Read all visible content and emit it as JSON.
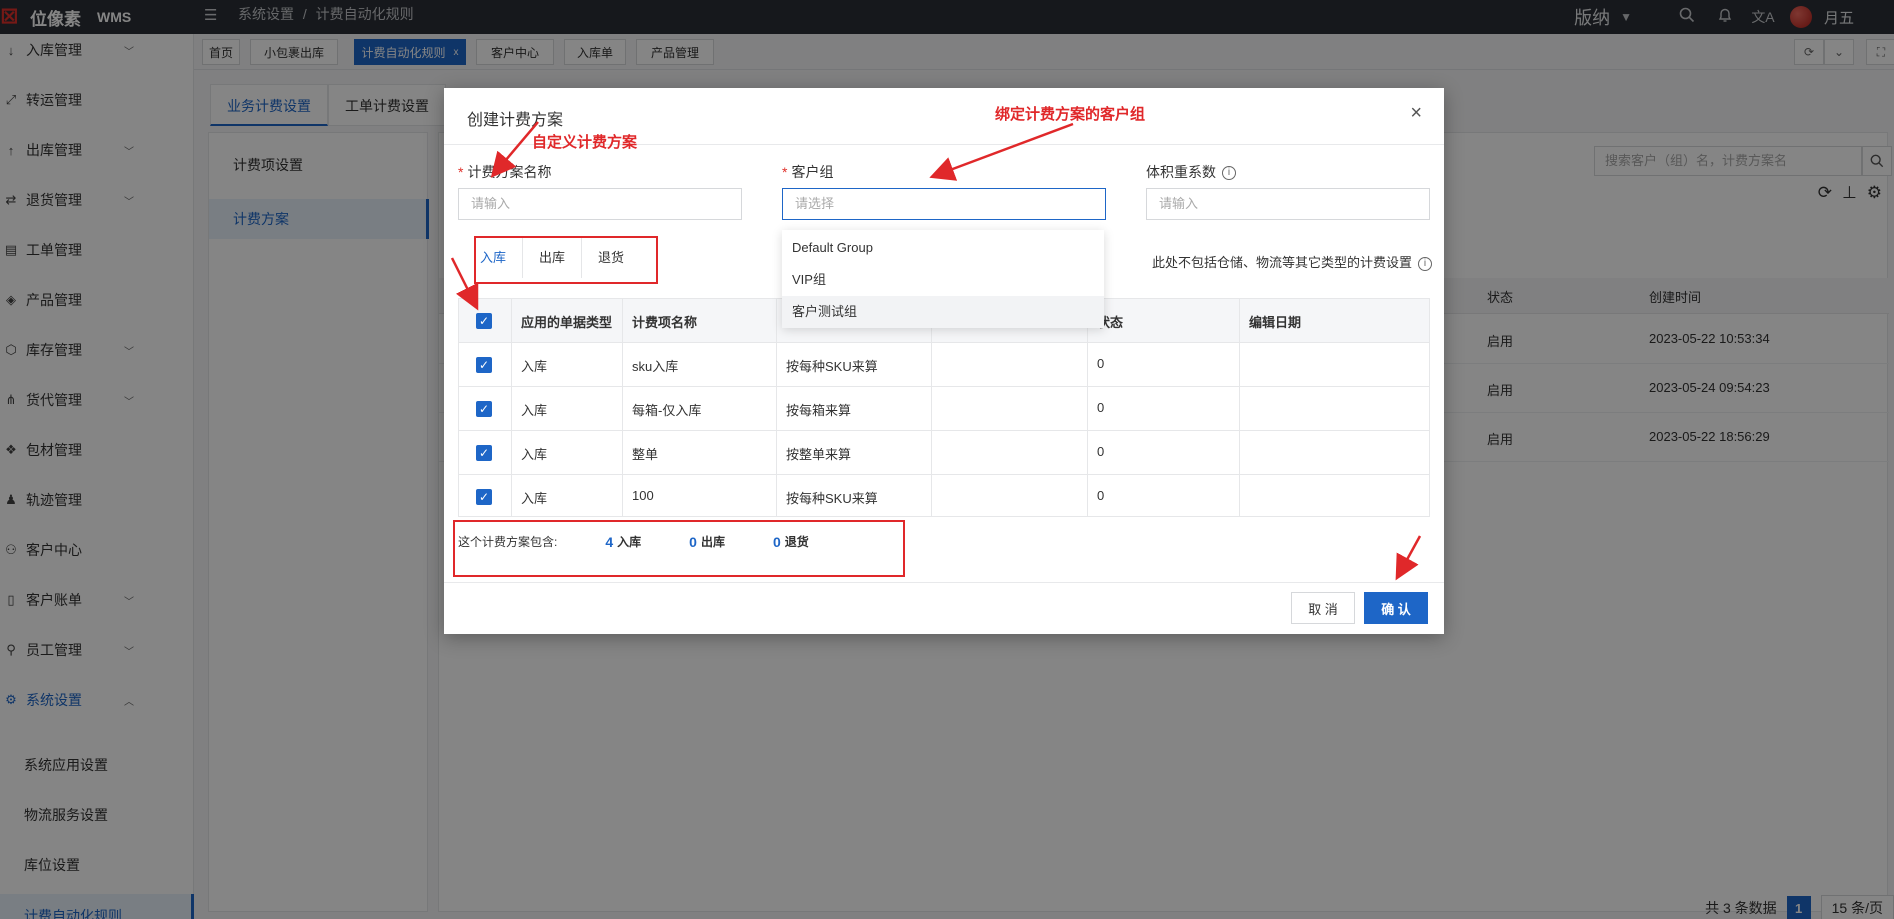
{
  "app": {
    "logo_cn": "位像素",
    "logo_en": "WMS",
    "breadcrumb": [
      "系统设置",
      "计费自动化规则"
    ],
    "breadcrumb_sep": "/",
    "warehouse": "版纳",
    "user": "月五"
  },
  "sidebar": {
    "items": [
      {
        "label": "入库管理",
        "icon": "arrow-down-icon",
        "caret": true
      },
      {
        "label": "转运管理",
        "icon": "transfer-icon",
        "caret": false
      },
      {
        "label": "出库管理",
        "icon": "arrow-up-icon",
        "caret": true
      },
      {
        "label": "退货管理",
        "icon": "return-icon",
        "caret": true
      },
      {
        "label": "工单管理",
        "icon": "clipboard-icon",
        "caret": false
      },
      {
        "label": "产品管理",
        "icon": "cube-icon",
        "caret": false
      },
      {
        "label": "库存管理",
        "icon": "box-icon",
        "caret": true
      },
      {
        "label": "货代管理",
        "icon": "network-icon",
        "caret": true
      },
      {
        "label": "包材管理",
        "icon": "package-icon",
        "caret": false
      },
      {
        "label": "轨迹管理",
        "icon": "bell-icon",
        "caret": false
      },
      {
        "label": "客户中心",
        "icon": "customer-icon",
        "caret": false
      },
      {
        "label": "客户账单",
        "icon": "bill-icon",
        "caret": true
      },
      {
        "label": "员工管理",
        "icon": "user-icon",
        "caret": true
      },
      {
        "label": "系统设置",
        "icon": "gear-icon",
        "caret": true,
        "expanded": true
      }
    ],
    "subitems": [
      {
        "label": "系统应用设置"
      },
      {
        "label": "物流服务设置"
      },
      {
        "label": "库位设置"
      },
      {
        "label": "计费自动化规则",
        "active": true
      }
    ]
  },
  "tabs": [
    {
      "label": "首页"
    },
    {
      "label": "小包裹出库"
    },
    {
      "label": "计费自动化规则",
      "active": true,
      "close": "x"
    },
    {
      "label": "客户中心"
    },
    {
      "label": "入库单"
    },
    {
      "label": "产品管理"
    }
  ],
  "page": {
    "subtabs": [
      "业务计费设置",
      "工单计费设置"
    ],
    "left_menu": [
      "计费项设置",
      "计费方案"
    ],
    "search_placeholder": "搜索客户（组）名，计费方案名",
    "bg_table": {
      "headers": [
        "状态",
        "创建时间"
      ],
      "rows": [
        [
          "启用",
          "2023-05-22 10:53:34"
        ],
        [
          "启用",
          "2023-05-24 09:54:23"
        ],
        [
          "启用",
          "2023-05-22 18:56:29"
        ]
      ]
    },
    "pager": {
      "total": "共 3 条数据",
      "page": "1",
      "size": "15 条/页"
    }
  },
  "modal": {
    "title": "创建计费方案",
    "close": "×",
    "fields": {
      "name_label": "计费方案名称",
      "name_placeholder": "请输入",
      "group_label": "客户组",
      "group_placeholder": "请选择",
      "volume_label": "体积重系数",
      "volume_placeholder": "请输入"
    },
    "tabs": [
      "入库",
      "出库",
      "退货"
    ],
    "note": "此处不包括仓储、物流等其它类型的计费设置",
    "table": {
      "headers": [
        "应用的单据类型",
        "计费项名称",
        "",
        "",
        "状态",
        "编辑日期"
      ],
      "rows": [
        [
          "入库",
          "sku入库",
          "按每种SKU来算",
          "",
          "0",
          ""
        ],
        [
          "入库",
          "每箱-仅入库",
          "按每箱来算",
          "",
          "0",
          ""
        ],
        [
          "入库",
          "整单",
          "按整单来算",
          "",
          "0",
          ""
        ],
        [
          "入库",
          "100",
          "按每种SKU来算",
          "",
          "0",
          ""
        ]
      ]
    },
    "summary": {
      "label": "这个计费方案包含:",
      "items": [
        {
          "num": "4",
          "label": "入库"
        },
        {
          "num": "0",
          "label": "出库"
        },
        {
          "num": "0",
          "label": "退货"
        }
      ]
    },
    "buttons": {
      "cancel": "取 消",
      "ok": "确 认"
    }
  },
  "dropdown": {
    "options": [
      "Default Group",
      "VIP组",
      "客户测试组"
    ]
  },
  "annotations": {
    "custom_plan": "自定义计费方案",
    "bind_group": "绑定计费方案的客户组"
  },
  "colors": {
    "accent": "#1e66c7",
    "annotation": "#e0282a",
    "topbar": "#2b2f36"
  }
}
